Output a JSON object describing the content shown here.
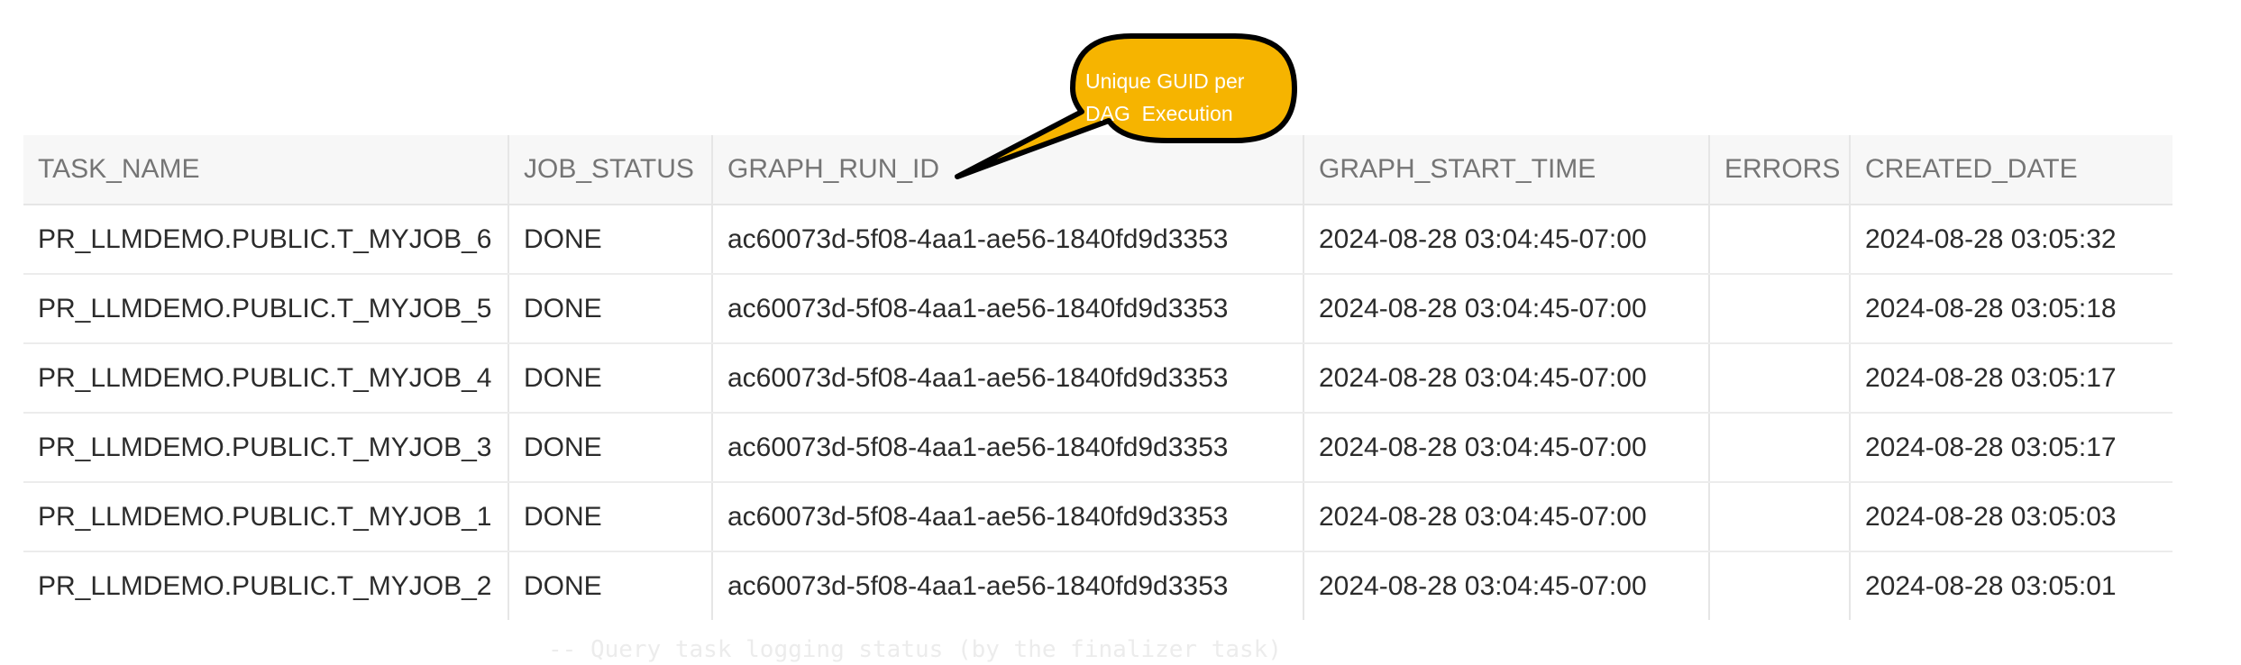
{
  "table": {
    "columns": [
      "TASK_NAME",
      "JOB_STATUS",
      "GRAPH_RUN_ID",
      "GRAPH_START_TIME",
      "ERRORS",
      "CREATED_DATE"
    ],
    "rows": [
      [
        "PR_LLMDEMO.PUBLIC.T_MYJOB_6",
        "DONE",
        "ac60073d-5f08-4aa1-ae56-1840fd9d3353",
        "2024-08-28 03:04:45-07:00",
        "",
        "2024-08-28 03:05:32"
      ],
      [
        "PR_LLMDEMO.PUBLIC.T_MYJOB_5",
        "DONE",
        "ac60073d-5f08-4aa1-ae56-1840fd9d3353",
        "2024-08-28 03:04:45-07:00",
        "",
        "2024-08-28 03:05:18"
      ],
      [
        "PR_LLMDEMO.PUBLIC.T_MYJOB_4",
        "DONE",
        "ac60073d-5f08-4aa1-ae56-1840fd9d3353",
        "2024-08-28 03:04:45-07:00",
        "",
        "2024-08-28 03:05:17"
      ],
      [
        "PR_LLMDEMO.PUBLIC.T_MYJOB_3",
        "DONE",
        "ac60073d-5f08-4aa1-ae56-1840fd9d3353",
        "2024-08-28 03:04:45-07:00",
        "",
        "2024-08-28 03:05:17"
      ],
      [
        "PR_LLMDEMO.PUBLIC.T_MYJOB_1",
        "DONE",
        "ac60073d-5f08-4aa1-ae56-1840fd9d3353",
        "2024-08-28 03:04:45-07:00",
        "",
        "2024-08-28 03:05:03"
      ],
      [
        "PR_LLMDEMO.PUBLIC.T_MYJOB_2",
        "DONE",
        "ac60073d-5f08-4aa1-ae56-1840fd9d3353",
        "2024-08-28 03:04:45-07:00",
        "",
        "2024-08-28 03:05:01"
      ]
    ]
  },
  "callout": {
    "line1": "Unique GUID per",
    "line2": "DAG  Execution",
    "fill_color": "#f6b400",
    "stroke_color": "#000000"
  },
  "footer": {
    "comment": "--  Query task logging status (by the finalizer task)"
  }
}
